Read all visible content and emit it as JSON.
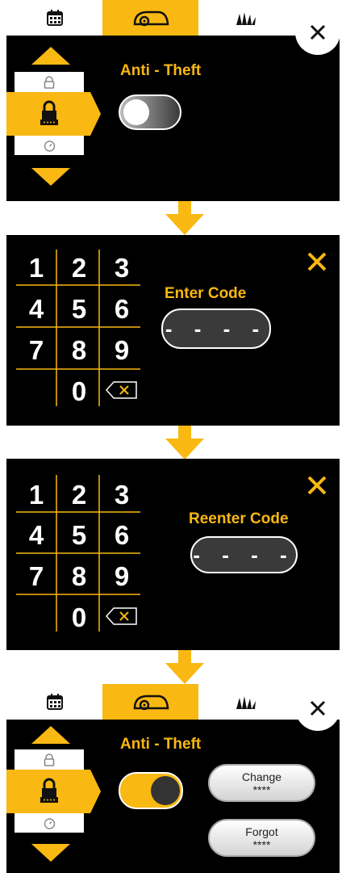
{
  "colors": {
    "accent": "#f9b812",
    "screen": "#000000"
  },
  "panel1": {
    "tabs": [
      {
        "icon": "calendar-icon"
      },
      {
        "icon": "mower-icon"
      },
      {
        "icon": "grass-icon"
      }
    ],
    "title": "Anti - Theft",
    "toggle_state": "off"
  },
  "panel2": {
    "keys": [
      "1",
      "2",
      "3",
      "4",
      "5",
      "6",
      "7",
      "8",
      "9",
      "0"
    ],
    "label": "Enter Code",
    "code": "- - - -"
  },
  "panel3": {
    "keys": [
      "1",
      "2",
      "3",
      "4",
      "5",
      "6",
      "7",
      "8",
      "9",
      "0"
    ],
    "label": "Reenter Code",
    "code": "- - - -"
  },
  "panel4": {
    "title": "Anti - Theft",
    "toggle_state": "on",
    "change_button": {
      "line1": "Change",
      "line2": "****"
    },
    "forgot_button": {
      "line1": "Forgot",
      "line2": "****"
    }
  }
}
